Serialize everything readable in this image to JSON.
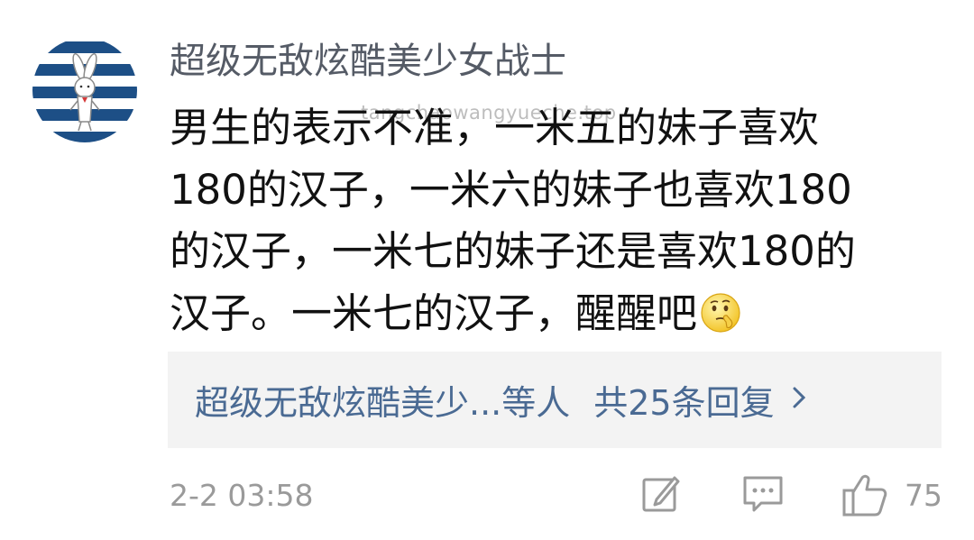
{
  "comment": {
    "username": "超级无敌炫酷美少女战士",
    "watermark": "tangchaowangyueche.top",
    "lines": [
      "男生的表示不准，一米五的妹子喜欢",
      "180的汉子，一米六的妹子也喜欢180",
      "的汉子，一米七的妹子还是喜欢180的",
      "汉子。一米七的汉子，醒醒吧"
    ],
    "emoji": "thinking-face-emoji",
    "replies": {
      "names": "超级无敌炫酷美少...等人",
      "count": "共25条回复"
    },
    "time": "2-2 03:58",
    "like_count": "75"
  },
  "icons": {
    "avatar": "striped-bunny-avatar",
    "edit": "edit-icon",
    "comment": "comment-icon",
    "like": "thumbs-up-icon",
    "reply_chevron": "chevron-right-icon"
  },
  "colors": {
    "username": "#555b66",
    "link": "#4a6a93",
    "meta": "#9a9a9a",
    "reply_bg": "#f3f3f3",
    "avatar_stripe": "#1d4f86"
  }
}
